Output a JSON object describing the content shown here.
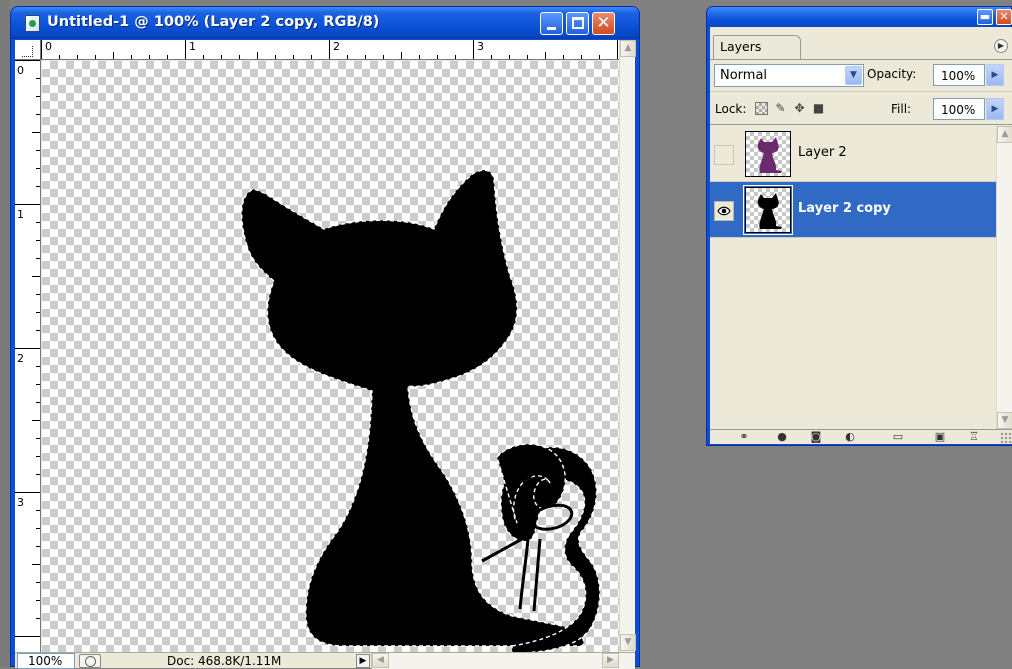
{
  "document": {
    "title": "Untitled-1 @ 100% (Layer 2 copy, RGB/8)",
    "ruler_top_labels": [
      "0",
      "1",
      "2",
      "3"
    ],
    "ruler_left_labels": [
      "0",
      "1",
      "2",
      "3"
    ],
    "status": {
      "zoom": "100%",
      "doc_info": "Doc: 468.8K/1.11M"
    }
  },
  "layers_palette": {
    "tab_label": "Layers",
    "blend_mode": "Normal",
    "opacity_label": "Opacity:",
    "opacity_value": "100%",
    "lock_label": "Lock:",
    "fill_label": "Fill:",
    "fill_value": "100%",
    "layers": [
      {
        "name": "Layer 2",
        "visible": false,
        "selected": false,
        "thumb_color": "#6b2a6e"
      },
      {
        "name": "Layer 2 copy",
        "visible": true,
        "selected": true,
        "thumb_color": "#000000"
      }
    ]
  },
  "colors": {
    "titlebar_blue": "#0a4fd6",
    "selection_blue": "#316ac5",
    "panel_bg": "#ece9d8",
    "desktop_gray": "#808080"
  }
}
